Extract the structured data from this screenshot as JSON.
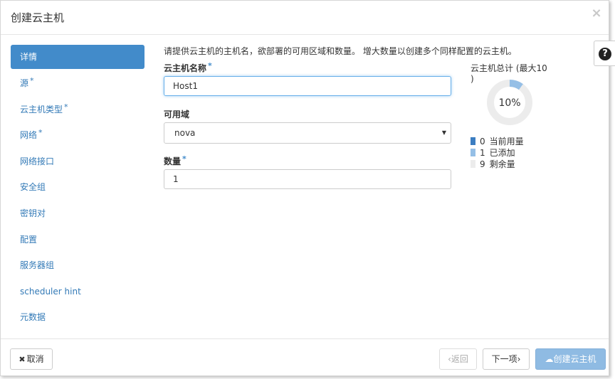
{
  "header": {
    "title": "创建云主机",
    "close_glyph": "×"
  },
  "help": {
    "glyph": "?"
  },
  "sidebar": {
    "items": [
      {
        "label": "详情",
        "required": false,
        "active": true
      },
      {
        "label": "源",
        "required": true,
        "active": false
      },
      {
        "label": "云主机类型",
        "required": true,
        "active": false
      },
      {
        "label": "网络",
        "required": true,
        "active": false
      },
      {
        "label": "网络接口",
        "required": false,
        "active": false
      },
      {
        "label": "安全组",
        "required": false,
        "active": false
      },
      {
        "label": "密钥对",
        "required": false,
        "active": false
      },
      {
        "label": "配置",
        "required": false,
        "active": false
      },
      {
        "label": "服务器组",
        "required": false,
        "active": false
      },
      {
        "label": "scheduler hint",
        "required": false,
        "active": false
      },
      {
        "label": "元数据",
        "required": false,
        "active": false
      }
    ],
    "required_mark": "*"
  },
  "main": {
    "intro": "请提供云主机的主机名，欲部署的可用区域和数量。 增大数量以创建多个同样配置的云主机。",
    "name_label": "云主机名称",
    "name_value": "Host1",
    "az_label": "可用域",
    "az_value": "nova",
    "count_label": "数量",
    "count_value": "1",
    "required_mark": "*"
  },
  "quota": {
    "title": "云主机总计 (最大10 )",
    "percent_label": "10%",
    "used_fraction": 0,
    "added_fraction": 0.1,
    "legend": [
      {
        "value": "0",
        "label": "当前用量",
        "color": "#3b7dc1"
      },
      {
        "value": "1",
        "label": "已添加",
        "color": "#95bfe6"
      },
      {
        "value": "9",
        "label": "剩余量",
        "color": "#ececec"
      }
    ]
  },
  "footer": {
    "cancel_label": "取消",
    "cancel_glyph": "✖",
    "back_label": "‹返回",
    "next_label": "下一项›",
    "create_label": "创建云主机",
    "create_glyph": "☁"
  },
  "colors": {
    "accent": "#428bca",
    "link": "#337ab7",
    "create_disabled": "#8fbbe3"
  }
}
